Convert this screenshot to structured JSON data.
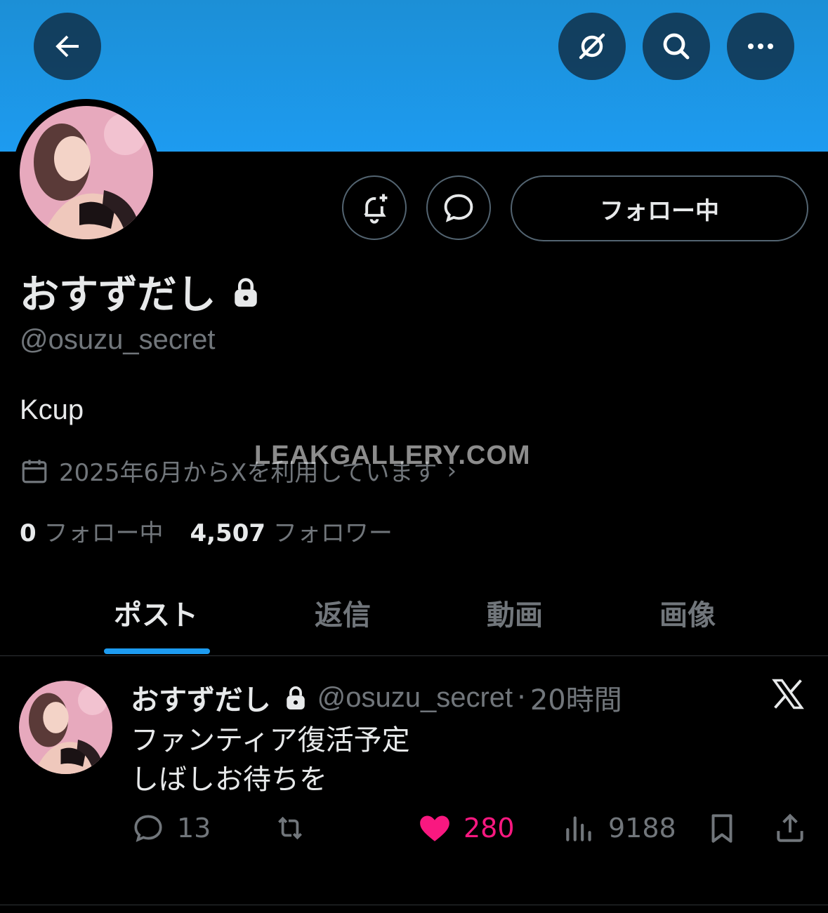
{
  "header": {
    "back_icon": "arrow-left-icon",
    "grok_icon": "grok-icon",
    "search_icon": "search-icon",
    "more_icon": "more-icon",
    "banner_color": "#1d9bf0"
  },
  "profile": {
    "display_name": "おすずだし",
    "handle": "@osuzu_secret",
    "bio": "Kcup",
    "joined": "2025年6月からXを利用しています",
    "following_count": "0",
    "following_label": "フォロー中",
    "followers_count": "4,507",
    "followers_label": "フォロワー",
    "follow_button": "フォロー中"
  },
  "watermark": "LEAKGALLERY.COM",
  "tabs": [
    "ポスト",
    "返信",
    "動画",
    "画像"
  ],
  "post": {
    "display_name": "おすずだし",
    "handle": "@osuzu_secret",
    "separator": "·",
    "time": "20時間",
    "text_line1": "ファンティア復活予定",
    "text_line2": "しばしお待ちを",
    "replies": "13",
    "likes": "280",
    "views": "9188"
  },
  "colors": {
    "accent": "#1d9bf0",
    "like": "#f91880",
    "muted": "#71767b"
  }
}
